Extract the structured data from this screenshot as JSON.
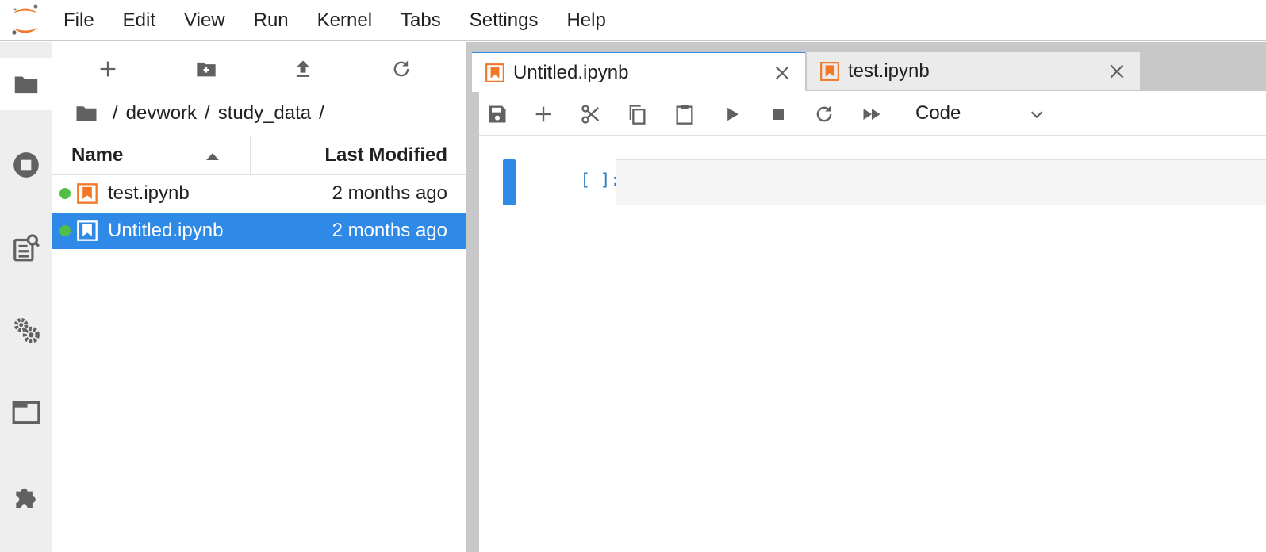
{
  "menubar": {
    "items": [
      "File",
      "Edit",
      "View",
      "Run",
      "Kernel",
      "Tabs",
      "Settings",
      "Help"
    ]
  },
  "activity_bar": {
    "buttons": [
      "folder-icon",
      "stop-circle-icon",
      "property-inspector-icon",
      "settings-gears-icon",
      "tab-panel-icon",
      "extension-puzzle-icon"
    ]
  },
  "file_browser": {
    "toolbar": [
      "new-launcher-icon",
      "new-folder-icon",
      "upload-icon",
      "refresh-icon"
    ],
    "breadcrumb": {
      "root_sep": "/",
      "parts": [
        "devwork",
        "study_data"
      ],
      "sep": "/"
    },
    "columns": {
      "name": "Name",
      "modified": "Last Modified"
    },
    "files": [
      {
        "name": "test.ipynb",
        "modified": "2 months ago",
        "running": true,
        "selected": false
      },
      {
        "name": "Untitled.ipynb",
        "modified": "2 months ago",
        "running": true,
        "selected": true
      }
    ]
  },
  "tabs": [
    {
      "label": "Untitled.ipynb",
      "active": true
    },
    {
      "label": "test.ipynb",
      "active": false
    }
  ],
  "notebook_toolbar": {
    "tools": [
      "save-icon",
      "add-cell-icon",
      "cut-icon",
      "copy-icon",
      "paste-icon",
      "run-icon",
      "stop-icon",
      "restart-icon",
      "fast-forward-icon"
    ],
    "cell_type": "Code"
  },
  "cell": {
    "prompt": "[ ]:",
    "source": ""
  },
  "colors": {
    "accent": "#2e8ae6",
    "notebook_icon": "#f37726",
    "running": "#4fbf45",
    "prompt": "#307fc1"
  }
}
